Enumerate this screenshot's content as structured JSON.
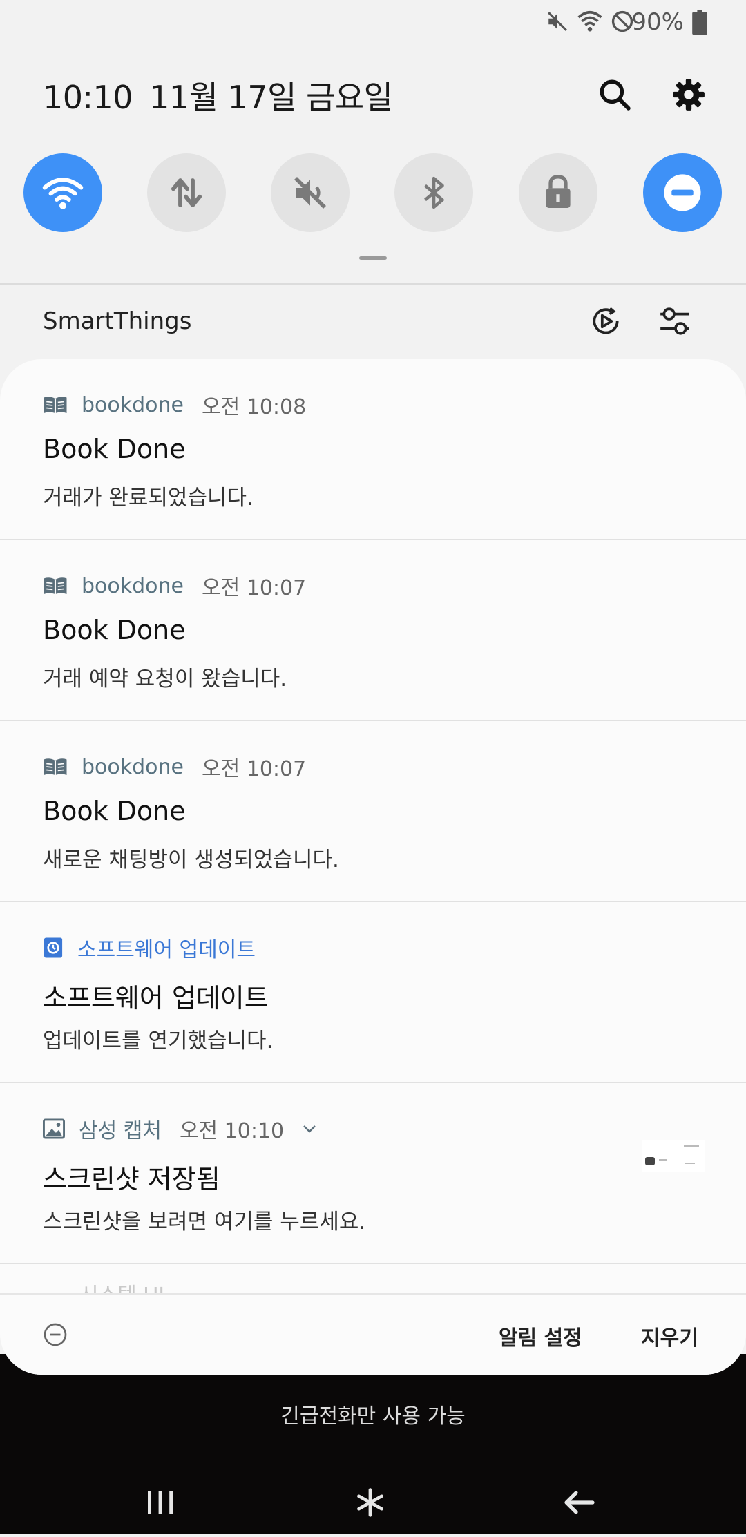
{
  "status_bar": {
    "battery_percent": "90%",
    "icons": [
      "mute-icon",
      "wifi-icon",
      "do-not-disturb-icon",
      "battery-icon"
    ]
  },
  "header": {
    "time": "10:10",
    "date": "11월 17일 금요일",
    "icons": [
      "search-icon",
      "gear-icon"
    ]
  },
  "quick_settings": [
    {
      "name": "wifi",
      "icon": "wifi-icon",
      "on": true
    },
    {
      "name": "mobile-data",
      "icon": "data-arrows-icon",
      "on": false
    },
    {
      "name": "sound",
      "icon": "mute-icon",
      "on": false
    },
    {
      "name": "bluetooth",
      "icon": "bluetooth-icon",
      "on": false
    },
    {
      "name": "rotation-lock",
      "icon": "lock-icon",
      "on": false
    },
    {
      "name": "do-not-disturb",
      "icon": "minus-circle-icon",
      "on": true
    }
  ],
  "smartthings": {
    "label": "SmartThings",
    "icons": [
      "media-output-icon",
      "device-settings-icon"
    ]
  },
  "notifications": [
    {
      "app": "bookdone",
      "time": "오전 10:08",
      "title": "Book Done",
      "text": "거래가 완료되었습니다."
    },
    {
      "app": "bookdone",
      "time": "오전 10:07",
      "title": "Book Done",
      "text": "거래 예약 요청이 왔습니다."
    },
    {
      "app": "bookdone",
      "time": "오전 10:07",
      "title": "Book Done",
      "text": "새로운 채팅방이 생성되었습니다."
    },
    {
      "app": "소프트웨어 업데이트",
      "time": "",
      "title": "소프트웨어 업데이트",
      "text": "업데이트를 연기했습니다."
    },
    {
      "app": "삼성 캡처",
      "time": "오전 10:10",
      "title": "스크린샷 저장됨",
      "text": "스크린샷을 보려면 여기를 누르세요."
    }
  ],
  "cutoff_notification": "시스템 UI",
  "panel_footer": {
    "notification_settings": "알림 설정",
    "clear": "지우기"
  },
  "lock_message": "긴급전화만 사용 가능",
  "colors": {
    "accent": "#3e91f7",
    "tile_off": "#e3e3e3",
    "app_blue": "#3b78d6"
  }
}
